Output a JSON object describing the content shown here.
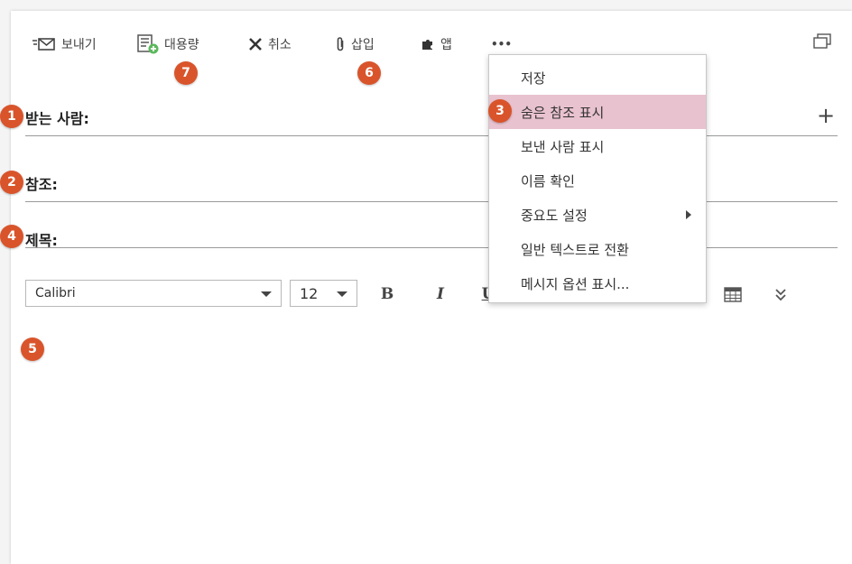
{
  "toolbar": {
    "send_label": "보내기",
    "capacity_label": "대용량",
    "cancel_label": "취소",
    "insert_label": "삽입",
    "apps_label": "앱",
    "more_label": "•••"
  },
  "fields": {
    "to_label": "받는 사람:",
    "cc_label": "참조:",
    "subject_label": "제목:",
    "add_label": "+"
  },
  "format": {
    "font": "Calibri",
    "size": "12",
    "bold": "B",
    "italic": "I",
    "underline": "U",
    "expand": "»"
  },
  "menu": {
    "items": [
      {
        "label": "저장"
      },
      {
        "label": "숨은 참조 표시"
      },
      {
        "label": "보낸 사람 표시"
      },
      {
        "label": "이름 확인"
      },
      {
        "label": "중요도 설정"
      },
      {
        "label": "일반 텍스트로 전환"
      },
      {
        "label": "메시지 옵션 표시..."
      }
    ]
  },
  "badges": {
    "b1": "1",
    "b2": "2",
    "b3": "3",
    "b4": "4",
    "b5": "5",
    "b6": "6",
    "b7": "7"
  },
  "colors": {
    "badge": "#d9542b",
    "menu_highlight": "#e9c2cf",
    "capacity_icon_green": "#5cb85c"
  }
}
